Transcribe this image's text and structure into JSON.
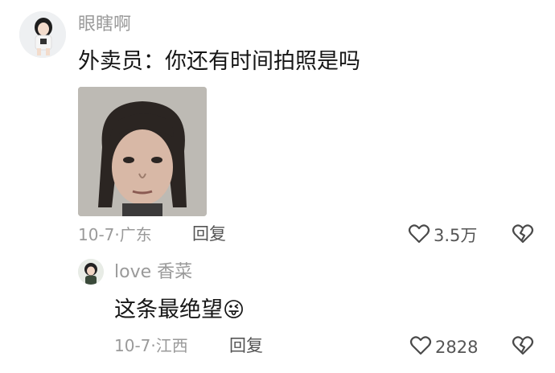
{
  "comments": [
    {
      "username": "眼瞎啊",
      "text": "外卖员：你还有时间拍照是吗",
      "date": "10-7",
      "separator": "·",
      "location": "广东",
      "reply_label": "回复",
      "likes": "3.5万",
      "has_image": true
    },
    {
      "username": "love 香菜",
      "text": "这条最绝望",
      "emoji": "😜",
      "date": "10-7",
      "separator": "·",
      "location": "江西",
      "reply_label": "回复",
      "likes": "2828"
    }
  ],
  "icons": {
    "like": "heart-outline-icon",
    "dislike": "broken-heart-icon"
  },
  "colors": {
    "username": "#9a9a9a",
    "meta": "#9a9a9a",
    "text": "#161616",
    "icon": "#4a4a4a"
  }
}
